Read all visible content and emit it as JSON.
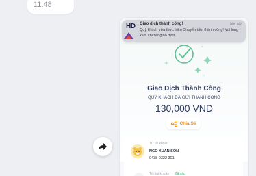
{
  "chat": {
    "timestamp": "11:48"
  },
  "notification": {
    "app_logo": "HD",
    "title": "Giao dịch thành công!",
    "time": "bây giờ",
    "body": "Quý khách vừa thực hiện Chuyển tiền thành công! Vui lòng xem chi tiết giao dịch."
  },
  "receipt": {
    "title": "Giao Dịch Thành Công",
    "subtitle": "QUÝ KHÁCH ĐÃ GỬI THÀNH CÔNG",
    "amount": "130,000 VND",
    "share_label": "Chia Sẻ",
    "from_label": "Từ tài khoản",
    "sender_name": "NGO XUAN SON",
    "sender_account": "0438 0322 301",
    "to_label": "Tới tài khoản",
    "to_status": "Đã xác"
  },
  "colors": {
    "accent_green": "#2fb37a",
    "share_orange": "#f08c00",
    "title_navy": "#2d3a5e"
  }
}
